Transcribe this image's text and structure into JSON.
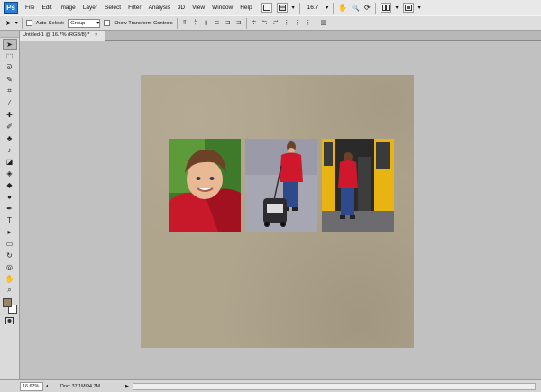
{
  "app": {
    "logo": "Ps"
  },
  "menu": [
    "File",
    "Edit",
    "Image",
    "Layer",
    "Select",
    "Filter",
    "Analysis",
    "3D",
    "View",
    "Window",
    "Help"
  ],
  "menubar_controls": {
    "zoom_value": "16.7",
    "zoom_arrow": "▾",
    "hand_glyph": "✋",
    "zoom_glyph": "🔍",
    "rotate_glyph": "⟳"
  },
  "options": {
    "auto_select_label": "Auto-Select:",
    "auto_select_value": "Group",
    "show_transform_label": "Show Transform Controls"
  },
  "document_tab": {
    "title": "Untitled-1 @ 16.7% (RGB/8) *",
    "close": "×"
  },
  "tools": [
    {
      "name": "move-tool-icon",
      "glyph": "➤"
    },
    {
      "name": "marquee-tool-icon",
      "glyph": "⬚"
    },
    {
      "name": "lasso-tool-icon",
      "glyph": "ᘐ"
    },
    {
      "name": "quick-select-tool-icon",
      "glyph": "✎"
    },
    {
      "name": "crop-tool-icon",
      "glyph": "⌗"
    },
    {
      "name": "eyedropper-tool-icon",
      "glyph": "⁄"
    },
    {
      "name": "healing-tool-icon",
      "glyph": "✚"
    },
    {
      "name": "brush-tool-icon",
      "glyph": "✐"
    },
    {
      "name": "stamp-tool-icon",
      "glyph": "♣"
    },
    {
      "name": "history-brush-icon",
      "glyph": "♪"
    },
    {
      "name": "eraser-tool-icon",
      "glyph": "◪"
    },
    {
      "name": "gradient-tool-icon",
      "glyph": "◈"
    },
    {
      "name": "blur-tool-icon",
      "glyph": "◆"
    },
    {
      "name": "dodge-tool-icon",
      "glyph": "●"
    },
    {
      "name": "pen-tool-icon",
      "glyph": "✒"
    },
    {
      "name": "type-tool-icon",
      "glyph": "T"
    },
    {
      "name": "path-select-tool-icon",
      "glyph": "▸"
    },
    {
      "name": "shape-tool-icon",
      "glyph": "▭"
    },
    {
      "name": "3d-rotate-tool-icon",
      "glyph": "↻"
    },
    {
      "name": "3d-orbit-tool-icon",
      "glyph": "◎"
    },
    {
      "name": "hand-tool-icon",
      "glyph": "✋"
    },
    {
      "name": "zoom-tool-icon",
      "glyph": "⌕"
    }
  ],
  "swatches": {
    "foreground": "#9c8467",
    "background": "#ffffff"
  },
  "status": {
    "zoom": "16.67%",
    "doc": "Doc: 37.1M/94.7M",
    "arrow": "▶"
  },
  "colors": {
    "paper": "#afa48c",
    "canvas_bg": "#c1c1c1"
  }
}
